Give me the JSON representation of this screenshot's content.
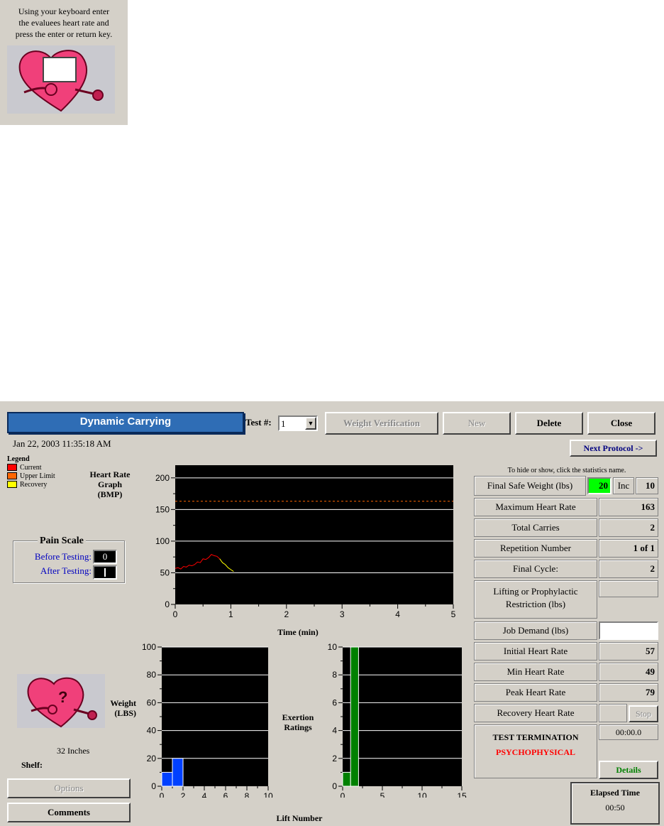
{
  "prompt": {
    "lines": [
      "Using your keyboard enter",
      "the evaluees heart rate and",
      "press the enter or return key."
    ],
    "heart_rate_input": ""
  },
  "window": {
    "title": "Dynamic Carrying",
    "test_label": "Test #:",
    "test_value": "1",
    "buttons": {
      "weight_verification": "Weight Verification",
      "new": "New",
      "delete": "Delete",
      "close": "Close",
      "next_protocol": "Next Protocol ->",
      "options": "Options",
      "comments": "Comments",
      "details": "Details",
      "stop": "Stop"
    },
    "timestamp": "Jan 22, 2003 11:35:18 AM"
  },
  "legend": {
    "title": "Legend",
    "items": [
      {
        "label": "Current",
        "color": "#ff0000"
      },
      {
        "label": "Upper Limit",
        "color": "#ff6600"
      },
      {
        "label": "Recovery",
        "color": "#ffff00"
      }
    ]
  },
  "pain_scale": {
    "title": "Pain Scale",
    "before_label": "Before Testing:",
    "before_value": "0",
    "after_label": "After Testing:",
    "after_value": ""
  },
  "heart_rate_graph": {
    "ylabel_lines": [
      "Heart Rate",
      "Graph",
      "(BMP)"
    ],
    "xlabel": "Time (min)"
  },
  "weight_graph": {
    "ylabel_lines": [
      "Weight",
      "(LBS)"
    ]
  },
  "exertion_graph": {
    "ylabel_lines": [
      "Exertion",
      "Ratings"
    ],
    "xlabel": "Lift Number"
  },
  "shelf": {
    "height_text": "32 Inches",
    "label": "Shelf:"
  },
  "stats": {
    "hint": "To hide or show, click the statistics name.",
    "final_safe_weight": {
      "name": "Final Safe Weight (lbs)",
      "value": "20",
      "inc_label": "Inc",
      "inc_value": "10"
    },
    "rows": [
      {
        "name": "Maximum Heart Rate",
        "value": "163"
      },
      {
        "name": "Total Carries",
        "value": "2"
      },
      {
        "name": "Repetition Number",
        "value": "1 of 1"
      },
      {
        "name": "Final Cycle:",
        "value": "2"
      },
      {
        "name": "Lifting or Prophylactic Restriction (lbs)",
        "value": ""
      },
      {
        "name": "Job Demand (lbs)",
        "value": ""
      },
      {
        "name": "Initial Heart Rate",
        "value": "57"
      },
      {
        "name": "Min Heart Rate",
        "value": "49"
      },
      {
        "name": "Peak Heart Rate",
        "value": "79"
      },
      {
        "name": "Recovery Heart Rate",
        "value": ""
      }
    ],
    "termination": {
      "title": "TEST TERMINATION",
      "reason": "PSYCHOPHYSICAL",
      "time": "00:00.0"
    },
    "elapsed": {
      "title": "Elapsed Time",
      "value": "00:50"
    }
  },
  "chart_data": [
    {
      "type": "line",
      "xlabel": "Time (min)",
      "ylabel": "Heart Rate Graph (BMP)",
      "xlim": [
        0,
        5
      ],
      "ylim": [
        0,
        220
      ],
      "xticks": [
        0,
        1,
        2,
        3,
        4,
        5
      ],
      "yticks": [
        0,
        50,
        100,
        150,
        200
      ],
      "grid": true,
      "upper_limit": 163,
      "series": [
        {
          "name": "Current",
          "color": "#ff0000",
          "x": [
            0,
            0.05,
            0.1,
            0.15,
            0.2,
            0.25,
            0.3,
            0.35,
            0.4,
            0.45,
            0.5,
            0.55,
            0.6,
            0.65,
            0.7,
            0.75,
            0.8
          ],
          "y": [
            57,
            58,
            56,
            60,
            59,
            62,
            61,
            63,
            67,
            66,
            72,
            71,
            74,
            79,
            77,
            76,
            72
          ]
        },
        {
          "name": "Recovery",
          "color": "#ffff00",
          "x": [
            0.8,
            0.85,
            0.9,
            0.95,
            1.0,
            1.05
          ],
          "y": [
            72,
            66,
            63,
            58,
            55,
            52
          ]
        }
      ]
    },
    {
      "type": "bar",
      "ylabel": "Weight (LBS)",
      "xlim": [
        0,
        10
      ],
      "ylim": [
        0,
        100
      ],
      "xticks": [
        0,
        2,
        4,
        6,
        8,
        10
      ],
      "yticks": [
        0,
        20,
        40,
        60,
        80,
        100
      ],
      "grid": true,
      "color": "#0040ff",
      "x": [
        1,
        2
      ],
      "values": [
        10,
        20
      ]
    },
    {
      "type": "bar",
      "xlabel": "Lift Number",
      "ylabel": "Exertion Ratings",
      "xlim": [
        0,
        15
      ],
      "ylim": [
        0,
        10
      ],
      "xticks": [
        0,
        5,
        10,
        15
      ],
      "yticks": [
        0,
        2,
        4,
        6,
        8,
        10
      ],
      "grid": true,
      "color": "#008000",
      "x": [
        1,
        2
      ],
      "values": [
        1,
        10
      ]
    }
  ]
}
